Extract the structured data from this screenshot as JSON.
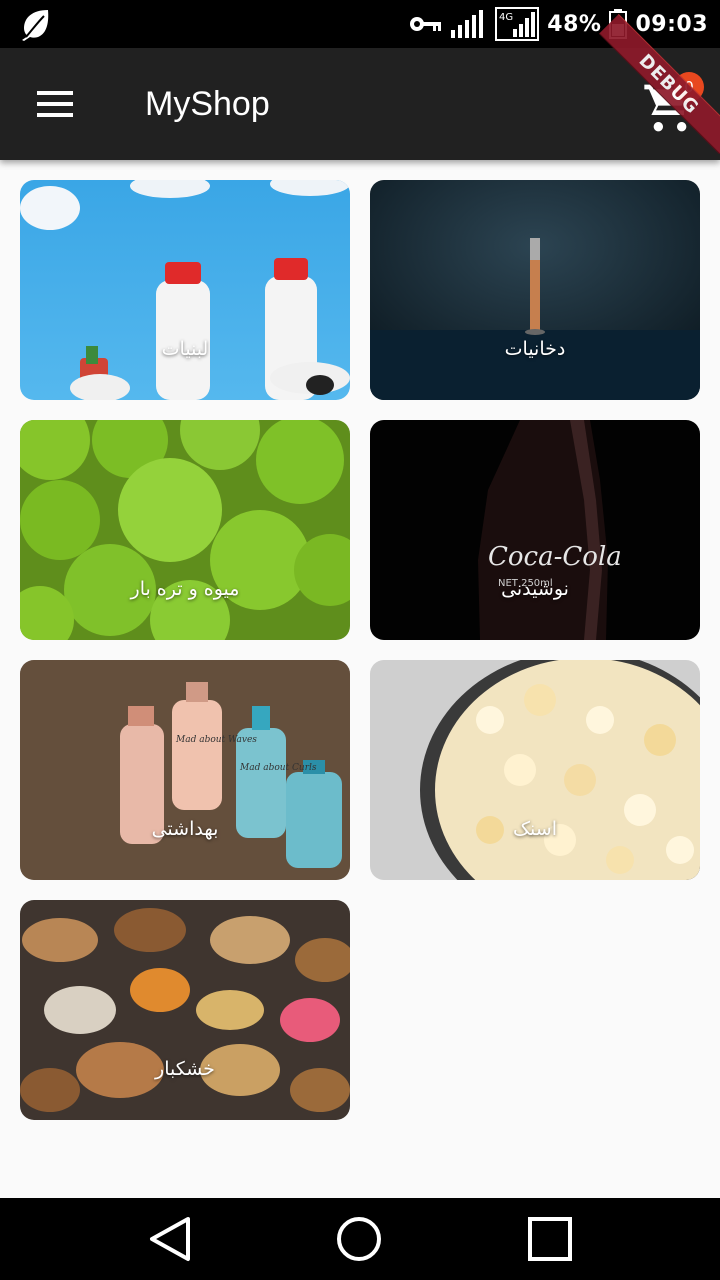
{
  "status_bar": {
    "battery_percent": "48%",
    "time": "09:03",
    "network": "4G",
    "icons": [
      "leaf-icon",
      "key-icon",
      "signal-icon",
      "signal-4g-icon",
      "battery-icon"
    ]
  },
  "app_bar": {
    "title": "MyShop",
    "cart_count": "0",
    "debug_banner": "DEBUG",
    "icons": [
      "menu-icon",
      "cart-icon"
    ]
  },
  "categories": [
    {
      "label": "لبنیات"
    },
    {
      "label": "دخانیات"
    },
    {
      "label": "میوه و تره بار"
    },
    {
      "label": "نوشیدنی"
    },
    {
      "label": "بهداشتی"
    },
    {
      "label": "اسنک"
    },
    {
      "label": "خشکبار"
    }
  ],
  "image_text": {
    "cola_logo": "Coca-Cola",
    "cola_volume": "NET 250ml",
    "bottle_text": "Mad about Waves",
    "bottle_text_2": "Mad about Curls"
  },
  "nav_bar": {
    "icons": [
      "back-icon",
      "home-icon",
      "recents-icon"
    ]
  },
  "colors": {
    "app_bar": "#212121",
    "background": "#fafafa",
    "badge": "#e8481f",
    "debug_ribbon": "#8e1a2a"
  }
}
